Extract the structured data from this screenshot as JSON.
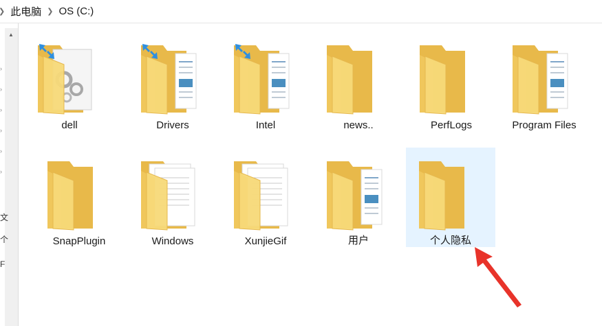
{
  "breadcrumb": {
    "items": [
      "此电脑",
      "OS (C:)"
    ]
  },
  "nav_fragments": [
    "文",
    "个",
    "F"
  ],
  "items": [
    {
      "label": "dell",
      "kind": "folder-gears",
      "shortcut": true,
      "selected": false
    },
    {
      "label": "Drivers",
      "kind": "folder-docs",
      "shortcut": true,
      "selected": false
    },
    {
      "label": "Intel",
      "kind": "folder-docs",
      "shortcut": true,
      "selected": false
    },
    {
      "label": "news..",
      "kind": "folder-empty",
      "shortcut": false,
      "selected": false
    },
    {
      "label": "PerfLogs",
      "kind": "folder-empty",
      "shortcut": false,
      "selected": false
    },
    {
      "label": "Program Files",
      "kind": "folder-docs",
      "shortcut": false,
      "selected": false
    },
    {
      "label": "SnapPlugin",
      "kind": "folder-empty",
      "shortcut": false,
      "selected": false
    },
    {
      "label": "Windows",
      "kind": "folder-pages",
      "shortcut": false,
      "selected": false
    },
    {
      "label": "XunjieGif",
      "kind": "folder-pages",
      "shortcut": false,
      "selected": false
    },
    {
      "label": "用户",
      "kind": "folder-docs",
      "shortcut": false,
      "selected": false
    },
    {
      "label": "个人隐私",
      "kind": "folder-empty",
      "shortcut": false,
      "selected": true
    }
  ],
  "colors": {
    "folder_back": "#e8b94a",
    "folder_front": "#f7d978",
    "selection": "#e5f3ff",
    "annotation_arrow": "#e8332a",
    "shortcut_arrow": "#2f8fe0"
  }
}
